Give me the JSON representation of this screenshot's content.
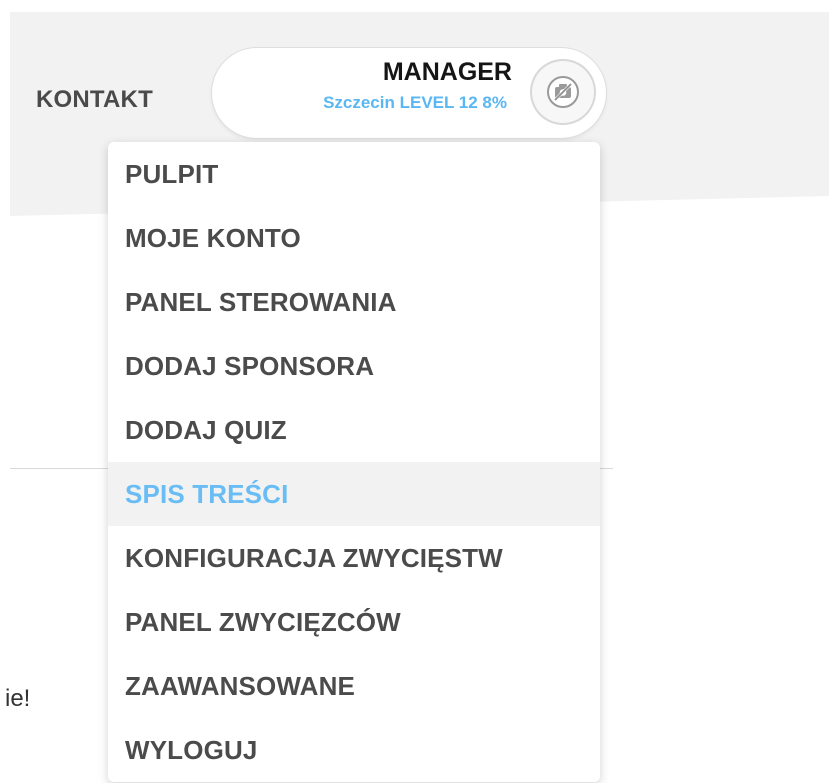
{
  "header": {
    "contact_label": "KONTAKT"
  },
  "user": {
    "role": "MANAGER",
    "location_level": "Szczecin LEVEL 12 8%",
    "avatar_icon": "camera-off-icon"
  },
  "content": {
    "partial_text": "ie!"
  },
  "menu": {
    "items": [
      {
        "label": "PULPIT"
      },
      {
        "label": "MOJE KONTO"
      },
      {
        "label": "PANEL STEROWANIA"
      },
      {
        "label": "DODAJ SPONSORA"
      },
      {
        "label": "DODAJ QUIZ"
      },
      {
        "label": "SPIS TREŚCI",
        "active": true
      },
      {
        "label": "KONFIGURACJA ZWYCIĘSTW"
      },
      {
        "label": "PANEL ZWYCIĘZCÓW"
      },
      {
        "label": "ZAAWANSOWANE"
      },
      {
        "label": "WYLOGUJ"
      }
    ]
  },
  "colors": {
    "accent": "#59b7f3",
    "text": "#4b4b4b",
    "header_bg": "#f2f2f2"
  }
}
